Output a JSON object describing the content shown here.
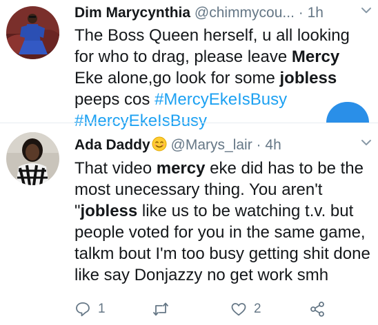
{
  "tweets": [
    {
      "display_name": "Dim Marycynthia",
      "handle": "@chimmycou...",
      "dot": "·",
      "time": "1h",
      "text": {
        "p1": "The Boss Queen herself, u all looking for who to drag, please leave ",
        "b1": "Mercy",
        "p2": " Eke alone,go look for some ",
        "b2": "jobless",
        "p3": " peeps cos ",
        "tag1": "#MercyEkeIsBusy",
        "p4": " ",
        "tag2": "#MercyEkeIsBusy"
      }
    },
    {
      "display_name": "Ada Daddy",
      "handle": "@Marys_lair",
      "dot": "·",
      "time": "4h",
      "text": {
        "p1": "That video ",
        "b1": "mercy",
        "p2": " eke did has to be the most unecessary thing. You aren't \"",
        "b2": "jobless",
        "p3": " like us to be watching t.v. but people voted for you in the same game, talkm bout I'm too busy getting shit done like say Donjazzy no get work smh"
      },
      "actions": {
        "reply_count": "1",
        "retweet_count": "",
        "like_count": "2"
      }
    }
  ],
  "colors": {
    "link": "#1da1f2",
    "muted": "#657786",
    "text": "#14171a",
    "divider": "#e6ecf0"
  },
  "icons": [
    "chevron-down-icon",
    "reply-icon",
    "retweet-icon",
    "heart-icon",
    "share-icon",
    "smiling-face-emoji"
  ]
}
